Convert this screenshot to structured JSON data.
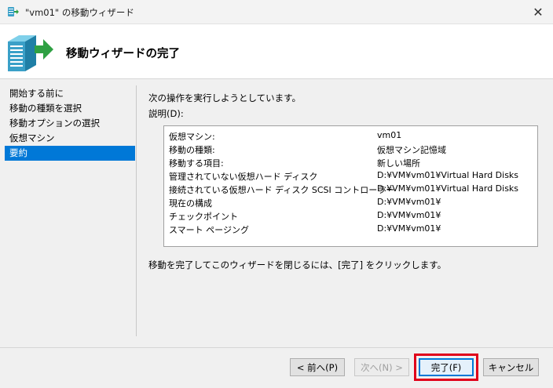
{
  "window": {
    "title": "\"vm01\" の移動ウィザード",
    "close_glyph": "✕"
  },
  "header": {
    "title": "移動ウィザードの完了",
    "icon": "server-arrow-icon"
  },
  "nav": {
    "items": [
      {
        "label": "開始する前に"
      },
      {
        "label": "移動の種類を選択"
      },
      {
        "label": "移動オプションの選択"
      },
      {
        "label": "仮想マシン"
      },
      {
        "label": "要約"
      }
    ],
    "selected_index": 4
  },
  "main": {
    "intro": "次の操作を実行しようとしています。",
    "description_label": "説明(D):",
    "description_rows": [
      {
        "key": "仮想マシン:",
        "value": "vm01"
      },
      {
        "key": "移動の種類:",
        "value": "仮想マシン記憶域"
      },
      {
        "key": "移動する項目:",
        "value": "新しい場所"
      },
      {
        "key": "管理されていない仮想ハード ディスク",
        "value": "D:¥VM¥vm01¥Virtual Hard Disks"
      },
      {
        "key": "接続されている仮想ハード ディスク SCSI コントローラー",
        "value": "D:¥VM¥vm01¥Virtual Hard Disks"
      },
      {
        "key": "現在の構成",
        "value": "D:¥VM¥vm01¥"
      },
      {
        "key": "チェックポイント",
        "value": "D:¥VM¥vm01¥"
      },
      {
        "key": "スマート ページング",
        "value": "D:¥VM¥vm01¥"
      }
    ],
    "finish_instruction": "移動を完了してこのウィザードを閉じるには、[完了] をクリックします。"
  },
  "buttons": {
    "back": "< 前へ(P)",
    "next": "次へ(N) >",
    "finish": "完了(F)",
    "cancel": "キャンセル"
  },
  "colors": {
    "selection": "#0078d7",
    "highlight_box": "#e0001a",
    "arrow": "#2ea043",
    "server": "#3aa0c8"
  }
}
